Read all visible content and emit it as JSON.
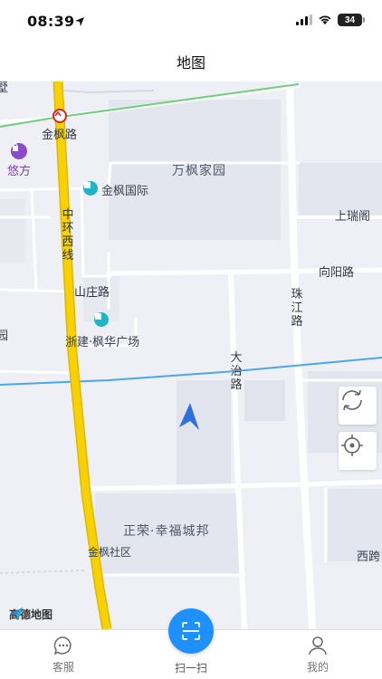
{
  "status": {
    "time": "08:39",
    "battery": "34"
  },
  "header": {
    "title": "地图"
  },
  "map": {
    "labels": {
      "jinfeng_road": "金枫路",
      "youfang": "悠方",
      "wanfeng": "万枫家园",
      "jinfeng_intl": "金枫国际",
      "shangrui": "上瑞阁",
      "zhonghuan": "中环西线",
      "xiangyang": "向阳路",
      "shanzhuang": "山庄路",
      "zhujiang": "珠江路",
      "fenghua": "浙建·枫华广场",
      "dazhi": "大治路",
      "zhengrong": "正荣·幸福城邦",
      "jinfeng_community": "金枫社区",
      "xikua": "西跨",
      "edge_left_top": "墅",
      "edge_left_mid": "园"
    },
    "brand": "高德地图"
  },
  "nav": {
    "service": "客服",
    "scan": "扫一扫",
    "mine": "我的"
  },
  "colors": {
    "accent": "#1e90ff",
    "highway": "#f7d200",
    "rail": "#4aa8e8"
  }
}
